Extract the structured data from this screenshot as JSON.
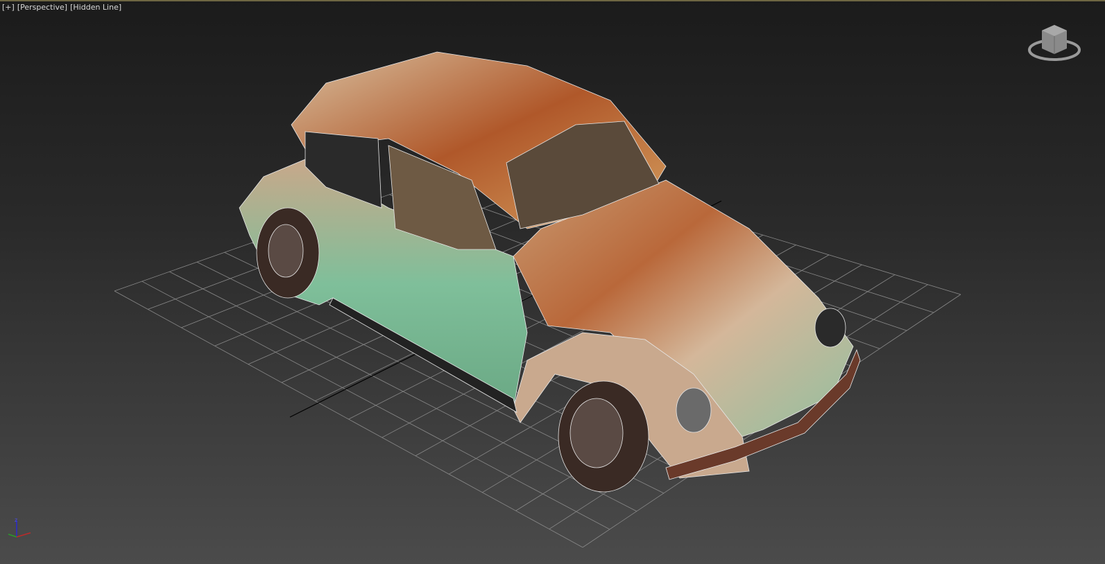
{
  "viewport": {
    "labels": {
      "menu": "[+]",
      "view": "[Perspective]",
      "shading": "[Hidden Line]"
    },
    "accent_border": "#6e6642"
  },
  "icons": [
    "viewcube-icon",
    "axis-tripod-icon"
  ],
  "axis_labels": {
    "z": "z"
  }
}
